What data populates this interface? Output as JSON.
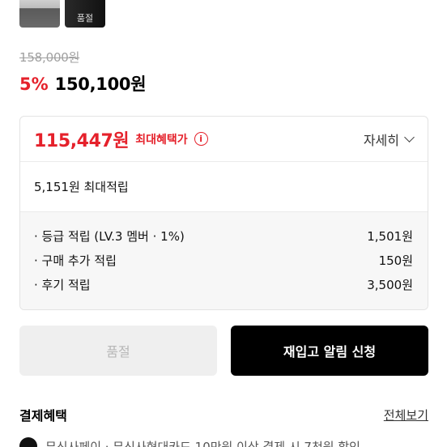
{
  "gallery": {
    "thumb2_label": "품절"
  },
  "price": {
    "original": "158,000원",
    "discount_rate": "5%",
    "sale": "150,100원"
  },
  "benefit": {
    "max_price": "115,447원",
    "max_label": "최대혜택가",
    "detail_label": "자세히",
    "accumulate_total": "5,151원 최대적립",
    "rows": [
      {
        "label": "· 등급 적립 (LV.3 멤버 · 1%)",
        "value": "1,501원"
      },
      {
        "label": "· 구매 추가 적립",
        "value": "150원"
      },
      {
        "label": "· 후기 적립",
        "value": "3,500원"
      }
    ]
  },
  "actions": {
    "soldout_label": "품절",
    "restock_label": "재입고 알림 신청"
  },
  "payment": {
    "title": "결제혜택",
    "view_all": "전체보기",
    "first_line": "무신사페이 · 무신사현대카드 10만원 이상 결제 시 7천원 할인"
  },
  "colors": {
    "accent_red": "#e5212b",
    "primary_black": "#000000"
  }
}
